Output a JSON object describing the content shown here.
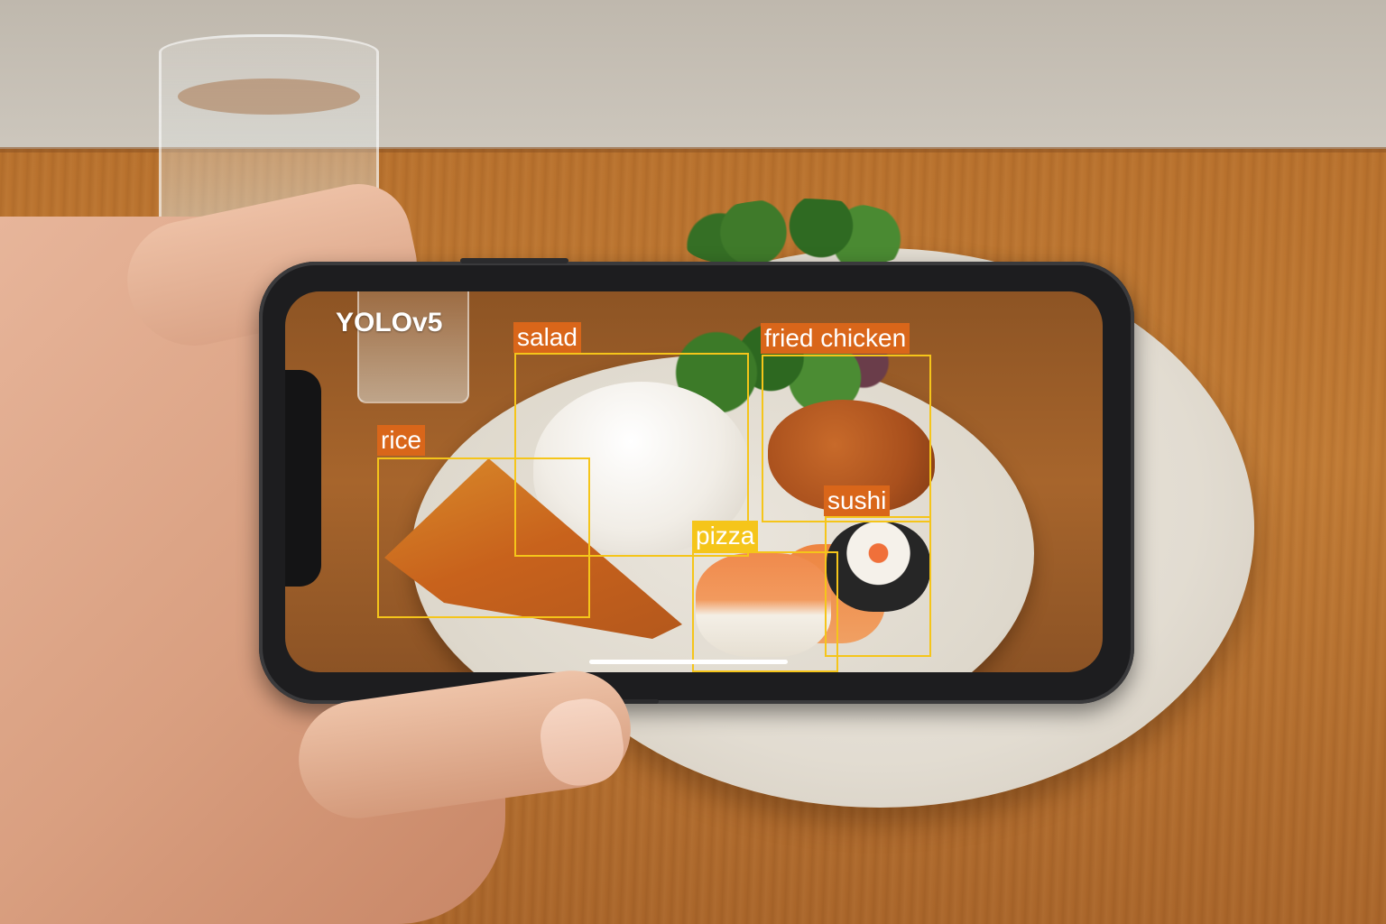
{
  "model": {
    "name": "YOLOv5"
  },
  "detections": [
    {
      "label": "salad"
    },
    {
      "label": "fried chicken"
    },
    {
      "label": "rice"
    },
    {
      "label": "sushi"
    },
    {
      "label": "pizza"
    }
  ],
  "colors": {
    "box_stroke": "#f5c51a",
    "tag_orange": "#d9661a",
    "tag_yellow": "#f5c51a",
    "phone_body": "#1d1d1f"
  },
  "icons": [
    "home-indicator-bar"
  ]
}
